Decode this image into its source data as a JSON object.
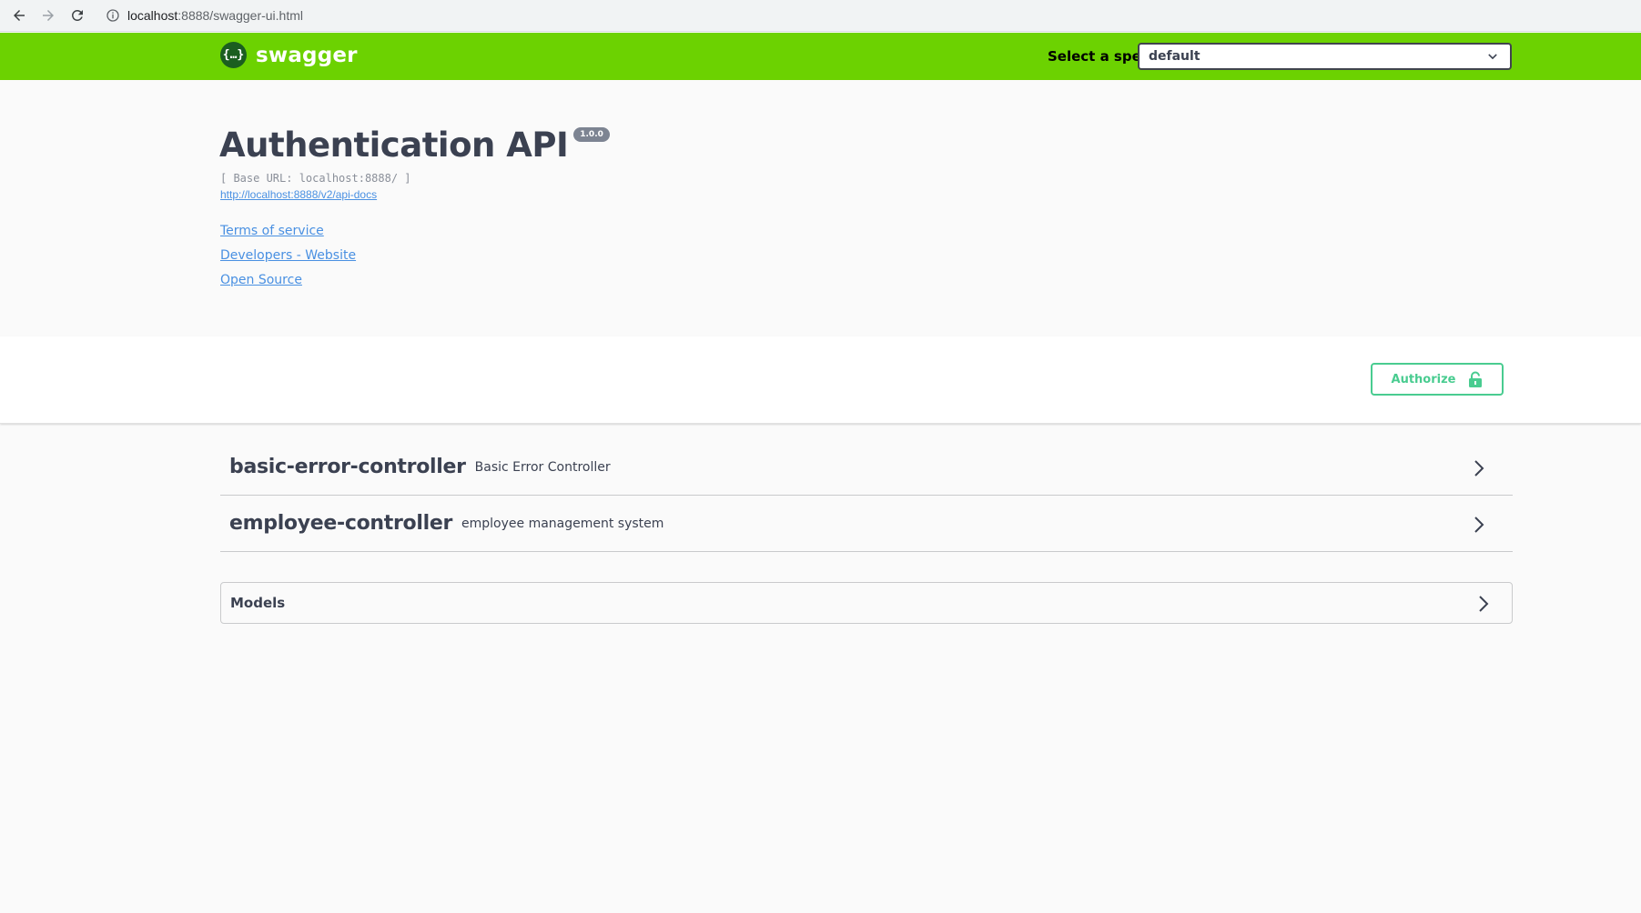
{
  "browser": {
    "url_host": "localhost",
    "url_rest": ":8888/swagger-ui.html"
  },
  "topbar": {
    "logo_glyph": "{…}",
    "logo_text": "swagger",
    "spec_label": "Select a spec",
    "spec_selected": "default",
    "color": "#6cd201"
  },
  "info": {
    "title": "Authentication API",
    "version": "1.0.0",
    "base_url": "[ Base URL: localhost:8888/ ]",
    "api_docs_link": "http://localhost:8888/v2/api-docs",
    "links": {
      "terms": "Terms of service",
      "developers": "Developers - Website",
      "license": "Open Source"
    }
  },
  "scheme": {
    "authorize_label": "Authorize",
    "authorize_color": "#49cc90"
  },
  "tags": [
    {
      "name": "basic-error-controller",
      "description": "Basic Error Controller"
    },
    {
      "name": "employee-controller",
      "description": "employee management system"
    }
  ],
  "models": {
    "title": "Models"
  }
}
